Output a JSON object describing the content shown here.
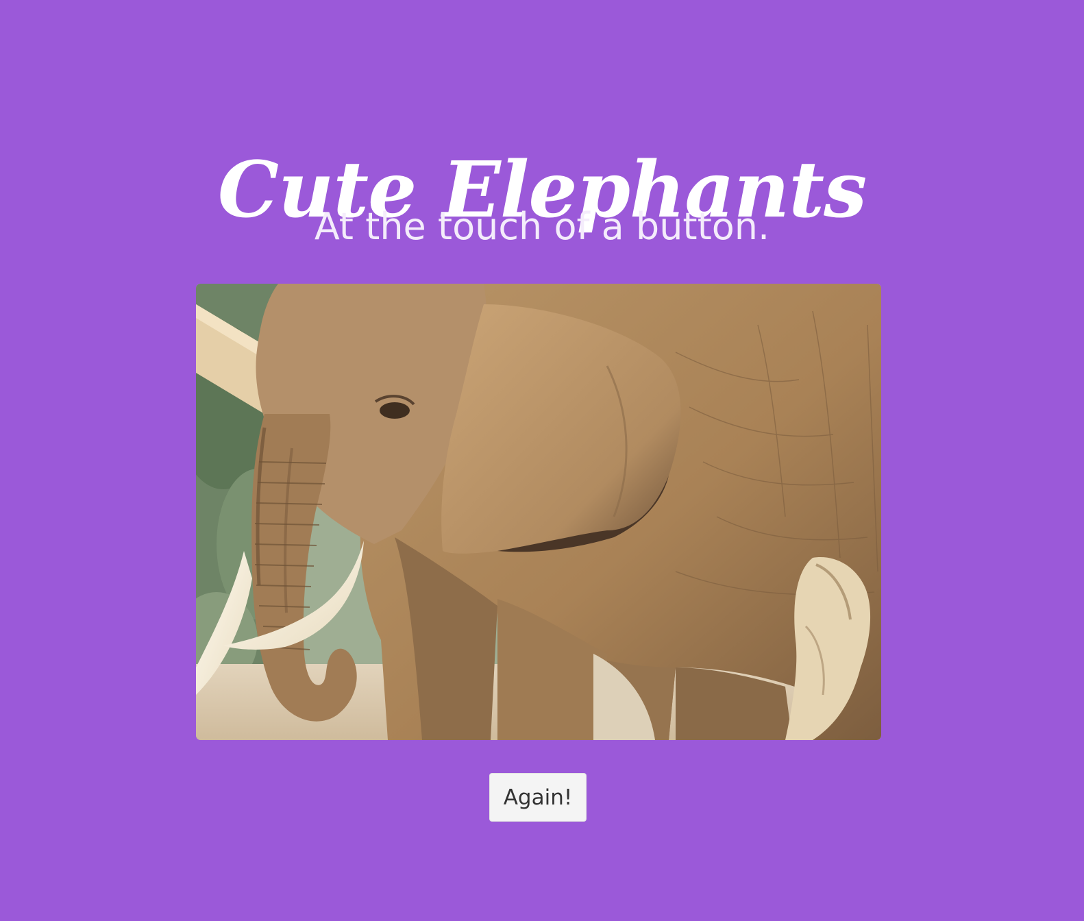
{
  "page": {
    "title": "Cute Elephants",
    "subtitle": "At the touch of a button.",
    "background_color": "#9b59d9"
  },
  "image": {
    "subject": "elephant"
  },
  "actions": {
    "again_label": "Again!"
  }
}
